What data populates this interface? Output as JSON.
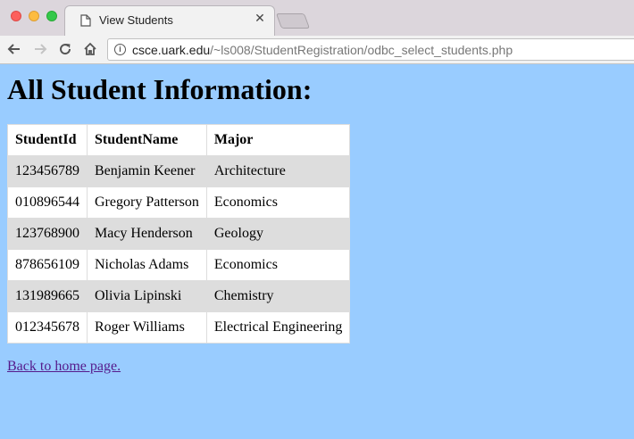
{
  "browser": {
    "tab_title": "View Students",
    "url_host": "csce.uark.edu",
    "url_path": "/~ls008/StudentRegistration/odbc_select_students.php"
  },
  "page": {
    "title": "All Student Information:",
    "table": {
      "headers": [
        "StudentId",
        "StudentName",
        "Major"
      ],
      "rows": [
        [
          "123456789",
          "Benjamin Keener",
          "Architecture"
        ],
        [
          "010896544",
          "Gregory Patterson",
          "Economics"
        ],
        [
          "123768900",
          "Macy Henderson",
          "Geology"
        ],
        [
          "878656109",
          "Nicholas Adams",
          "Economics"
        ],
        [
          "131989665",
          "Olivia Lipinski",
          "Chemistry"
        ],
        [
          "012345678",
          "Roger Williams",
          "Electrical Engineering"
        ]
      ]
    },
    "home_link": "Back to home page."
  },
  "colors": {
    "page_background": "#99ccff",
    "row_alt": "#dddddd",
    "visited_link": "#551a8b"
  }
}
